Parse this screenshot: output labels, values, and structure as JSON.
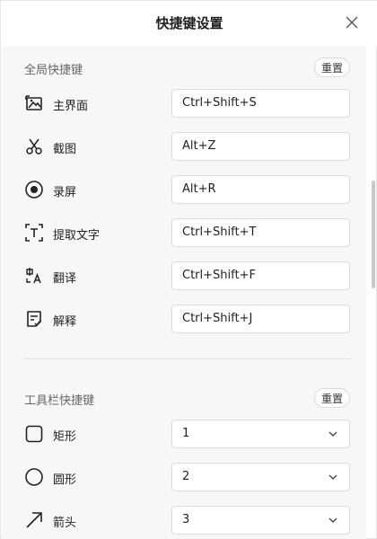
{
  "header": {
    "title": "快捷键设置"
  },
  "global": {
    "title": "全局快捷键",
    "reset_label": "重置",
    "items": [
      {
        "icon": "screenshot-main-icon",
        "label": "主界面",
        "value": "Ctrl+Shift+S"
      },
      {
        "icon": "scissors-icon",
        "label": "截图",
        "value": "Alt+Z"
      },
      {
        "icon": "record-icon",
        "label": "录屏",
        "value": "Alt+R"
      },
      {
        "icon": "text-extract-icon",
        "label": "提取文字",
        "value": "Ctrl+Shift+T"
      },
      {
        "icon": "translate-icon",
        "label": "翻译",
        "value": "Ctrl+Shift+F"
      },
      {
        "icon": "explain-icon",
        "label": "解释",
        "value": "Ctrl+Shift+J"
      }
    ]
  },
  "toolbar": {
    "title": "工具栏快捷键",
    "reset_label": "重置",
    "items": [
      {
        "icon": "rectangle-icon",
        "label": "矩形",
        "value": "1"
      },
      {
        "icon": "circle-icon",
        "label": "圆形",
        "value": "2"
      },
      {
        "icon": "arrow-icon",
        "label": "箭头",
        "value": "3"
      }
    ]
  }
}
